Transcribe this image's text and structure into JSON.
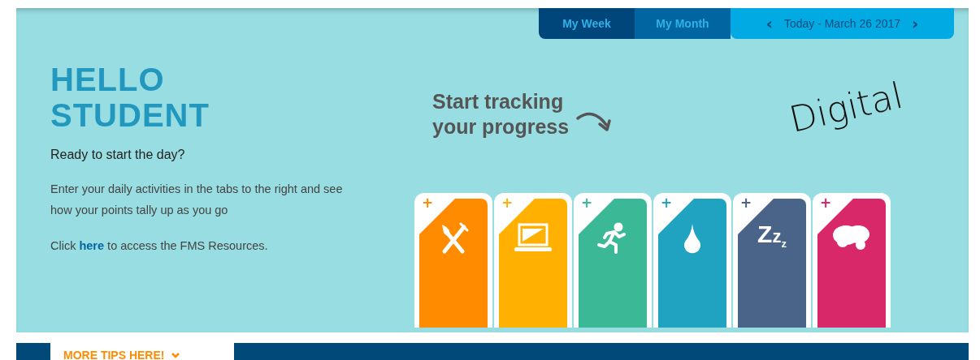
{
  "tabs": [
    {
      "label": "My Week",
      "selected": true
    },
    {
      "label": "My Month",
      "selected": false
    }
  ],
  "date_nav": {
    "prev": "‹",
    "label": "Today - March 26 2017",
    "next": "›"
  },
  "greeting": {
    "title_lines": [
      "HELLO",
      "STUDENT"
    ],
    "subtitle": "Ready to start the day?",
    "body": "Enter your daily activities in the tabs to the right and see how your points tally up as you go",
    "resources": {
      "before": "Click ",
      "link": "here",
      "after": " to access the FMS Resources."
    }
  },
  "prompt": {
    "lines": [
      "Start tracking",
      "your progress"
    ]
  },
  "annotation": "Digital",
  "activity_cards": [
    {
      "kind": "food",
      "color": "#ff8c00",
      "add": "+"
    },
    {
      "kind": "screen",
      "color": "#ffb000",
      "add": "+"
    },
    {
      "kind": "exercise",
      "color": "#3bb896",
      "add": "+"
    },
    {
      "kind": "water",
      "color": "#1fa3c0",
      "add": "+"
    },
    {
      "kind": "sleep",
      "color": "#4a6389",
      "add": "+",
      "glyph": "Zzz"
    },
    {
      "kind": "mind",
      "color": "#d9286a",
      "add": "+"
    }
  ],
  "tips": {
    "label": "MORE TIPS HERE!"
  }
}
